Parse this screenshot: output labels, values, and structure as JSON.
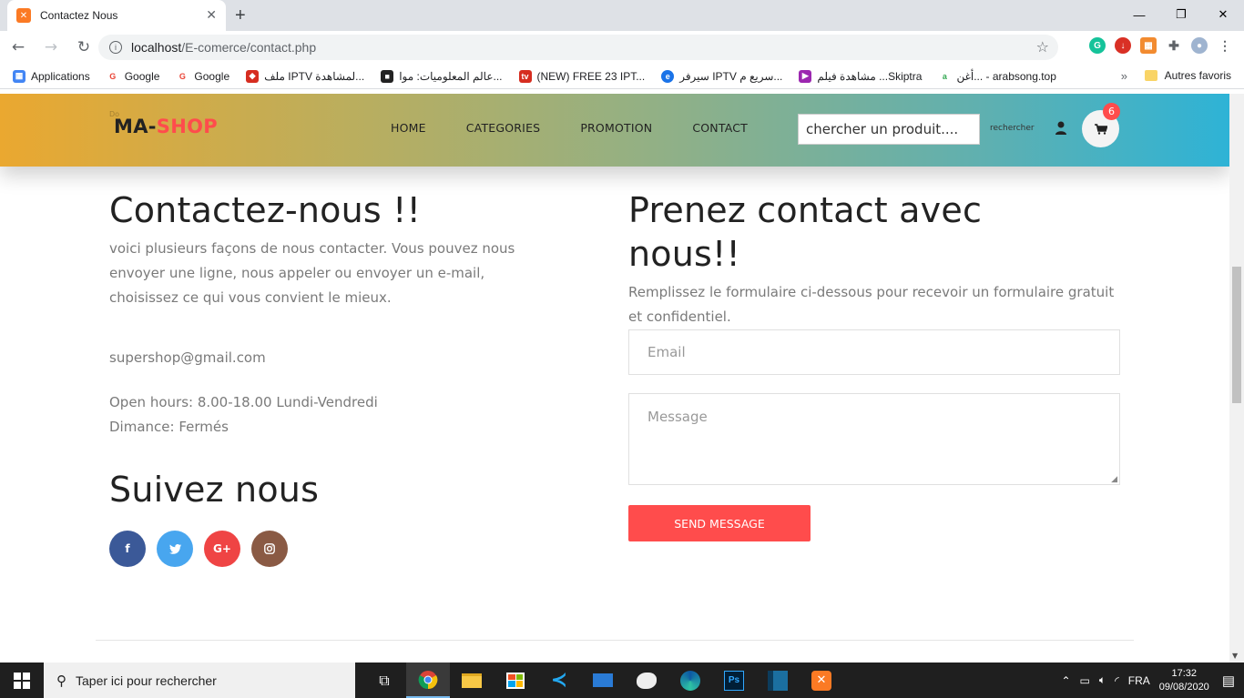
{
  "browser": {
    "tab_title": "Contactez Nous",
    "url_host": "localhost",
    "url_path": "/E-comerce/contact.php",
    "bookmarks": [
      {
        "label": "Applications",
        "color": "#4285f4"
      },
      {
        "label": "Google",
        "color": "#ea4335"
      },
      {
        "label": "Google",
        "color": "#ea4335"
      },
      {
        "label": "ملف IPTV لمشاهدة...",
        "color": "#d62d20"
      },
      {
        "label": "عالم المعلوميات: موا...",
        "color": "#222222"
      },
      {
        "label": "(NEW) FREE 23 IPT...",
        "color": "#d62d20"
      },
      {
        "label": "سيرفر IPTV سريع م...",
        "color": "#1a73e8"
      },
      {
        "label": "مشاهدة فيلم ...Skiptra",
        "color": "#9c27b0"
      },
      {
        "label": "أغن... - arabsong.top",
        "color": "#34a853"
      }
    ],
    "bookmarks_more": "»",
    "other_bookmarks": "Autres favoris"
  },
  "site": {
    "logo_small": "Do",
    "logo_ma": "MA-",
    "logo_shop": "SHOP",
    "menu": [
      "HOME",
      "CATEGORIES",
      "PROMOTION",
      "CONTACT"
    ],
    "search_placeholder": "chercher un produit....",
    "search_button": "rechercher",
    "cart_count": "6"
  },
  "contact": {
    "title": "Contactez-nous !!",
    "intro": "voici plusieurs façons de nous contacter. Vous pouvez nous envoyer une ligne, nous appeler ou envoyer un e-mail, choisissez ce qui vous convient le mieux.",
    "email": "supershop@gmail.com",
    "hours_line1": "Open hours: 8.00-18.00 Lundi-Vendredi",
    "hours_line2": "Dimance: Fermés",
    "follow_title": "Suivez nous",
    "social": [
      {
        "label": "f",
        "name": "facebook",
        "color": "#3b5998"
      },
      {
        "label": "t",
        "name": "twitter",
        "color": "#48a6ef"
      },
      {
        "label": "G+",
        "name": "google-plus",
        "color": "#ef4444"
      },
      {
        "label": "◎",
        "name": "instagram",
        "color": "#8a5a44"
      }
    ]
  },
  "form": {
    "title_line1": "Prenez contact avec",
    "title_line2": "nous!!",
    "description": "Remplissez le formulaire ci-dessous pour recevoir un formulaire gratuit et confidentiel.",
    "email_placeholder": "Email",
    "message_placeholder": "Message",
    "send_label": "SEND MESSAGE"
  },
  "taskbar": {
    "search_placeholder": "Taper ici pour rechercher",
    "language": "FRA",
    "time": "17:32",
    "date": "09/08/2020"
  }
}
